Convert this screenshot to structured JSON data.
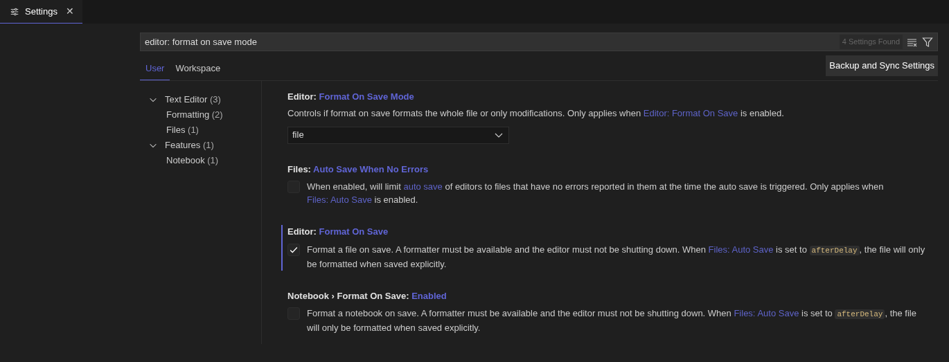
{
  "editor_tab": {
    "title": "Settings",
    "close": "✕",
    "selected": true
  },
  "search": {
    "value": "editor: format on save mode",
    "result_count": "4 Settings Found"
  },
  "scope_tabs": [
    {
      "label": "User",
      "selected": true
    },
    {
      "label": "Workspace",
      "selected": false
    }
  ],
  "sync_button": "Backup and Sync Settings",
  "tree": [
    {
      "label": "Text Editor",
      "count": "(3)",
      "expanded": true,
      "children": [
        {
          "label": "Formatting",
          "count": "(2)"
        },
        {
          "label": "Files",
          "count": "(1)"
        }
      ]
    },
    {
      "label": "Features",
      "count": "(1)",
      "expanded": true,
      "children": [
        {
          "label": "Notebook",
          "count": "(1)"
        }
      ]
    }
  ],
  "settings": [
    {
      "category": "Editor:",
      "name": "Format On Save Mode",
      "focused": false,
      "kind": "dropdown",
      "value": "file",
      "description": [
        {
          "kind": "text",
          "text": "Controls if format on save formats the whole file or only modifications. Only applies when "
        },
        {
          "kind": "link",
          "text": "Editor: Format On Save"
        },
        {
          "kind": "text",
          "text": " is enabled."
        }
      ]
    },
    {
      "category": "Files:",
      "name": "Auto Save When No Errors",
      "focused": false,
      "kind": "checkbox",
      "checked": false,
      "description": [
        {
          "kind": "text",
          "text": "When enabled, will limit "
        },
        {
          "kind": "link",
          "text": "auto save"
        },
        {
          "kind": "text",
          "text": " of editors to files that have no errors reported in them at the time the auto save is triggered. Only applies when "
        },
        {
          "kind": "link",
          "text": "Files: Auto Save"
        },
        {
          "kind": "text",
          "text": " is enabled."
        }
      ]
    },
    {
      "category": "Editor:",
      "name": "Format On Save",
      "focused": true,
      "kind": "checkbox",
      "checked": true,
      "description": [
        {
          "kind": "text",
          "text": "Format a file on save. A formatter must be available and the editor must not be shutting down. When "
        },
        {
          "kind": "link",
          "text": "Files: Auto Save"
        },
        {
          "kind": "text",
          "text": " is set to "
        },
        {
          "kind": "code",
          "text": "afterDelay"
        },
        {
          "kind": "text",
          "text": ", the file will only be formatted when saved explicitly."
        }
      ]
    },
    {
      "category": "Notebook › Format On Save:",
      "name": "Enabled",
      "focused": false,
      "kind": "checkbox",
      "checked": false,
      "description": [
        {
          "kind": "text",
          "text": "Format a notebook on save. A formatter must be available and the editor must not be shutting down. When "
        },
        {
          "kind": "link",
          "text": "Files: Auto Save"
        },
        {
          "kind": "text",
          "text": " is set to "
        },
        {
          "kind": "code",
          "text": "afterDelay"
        },
        {
          "kind": "text",
          "text": ", the file will only be formatted when saved explicitly."
        }
      ]
    }
  ]
}
